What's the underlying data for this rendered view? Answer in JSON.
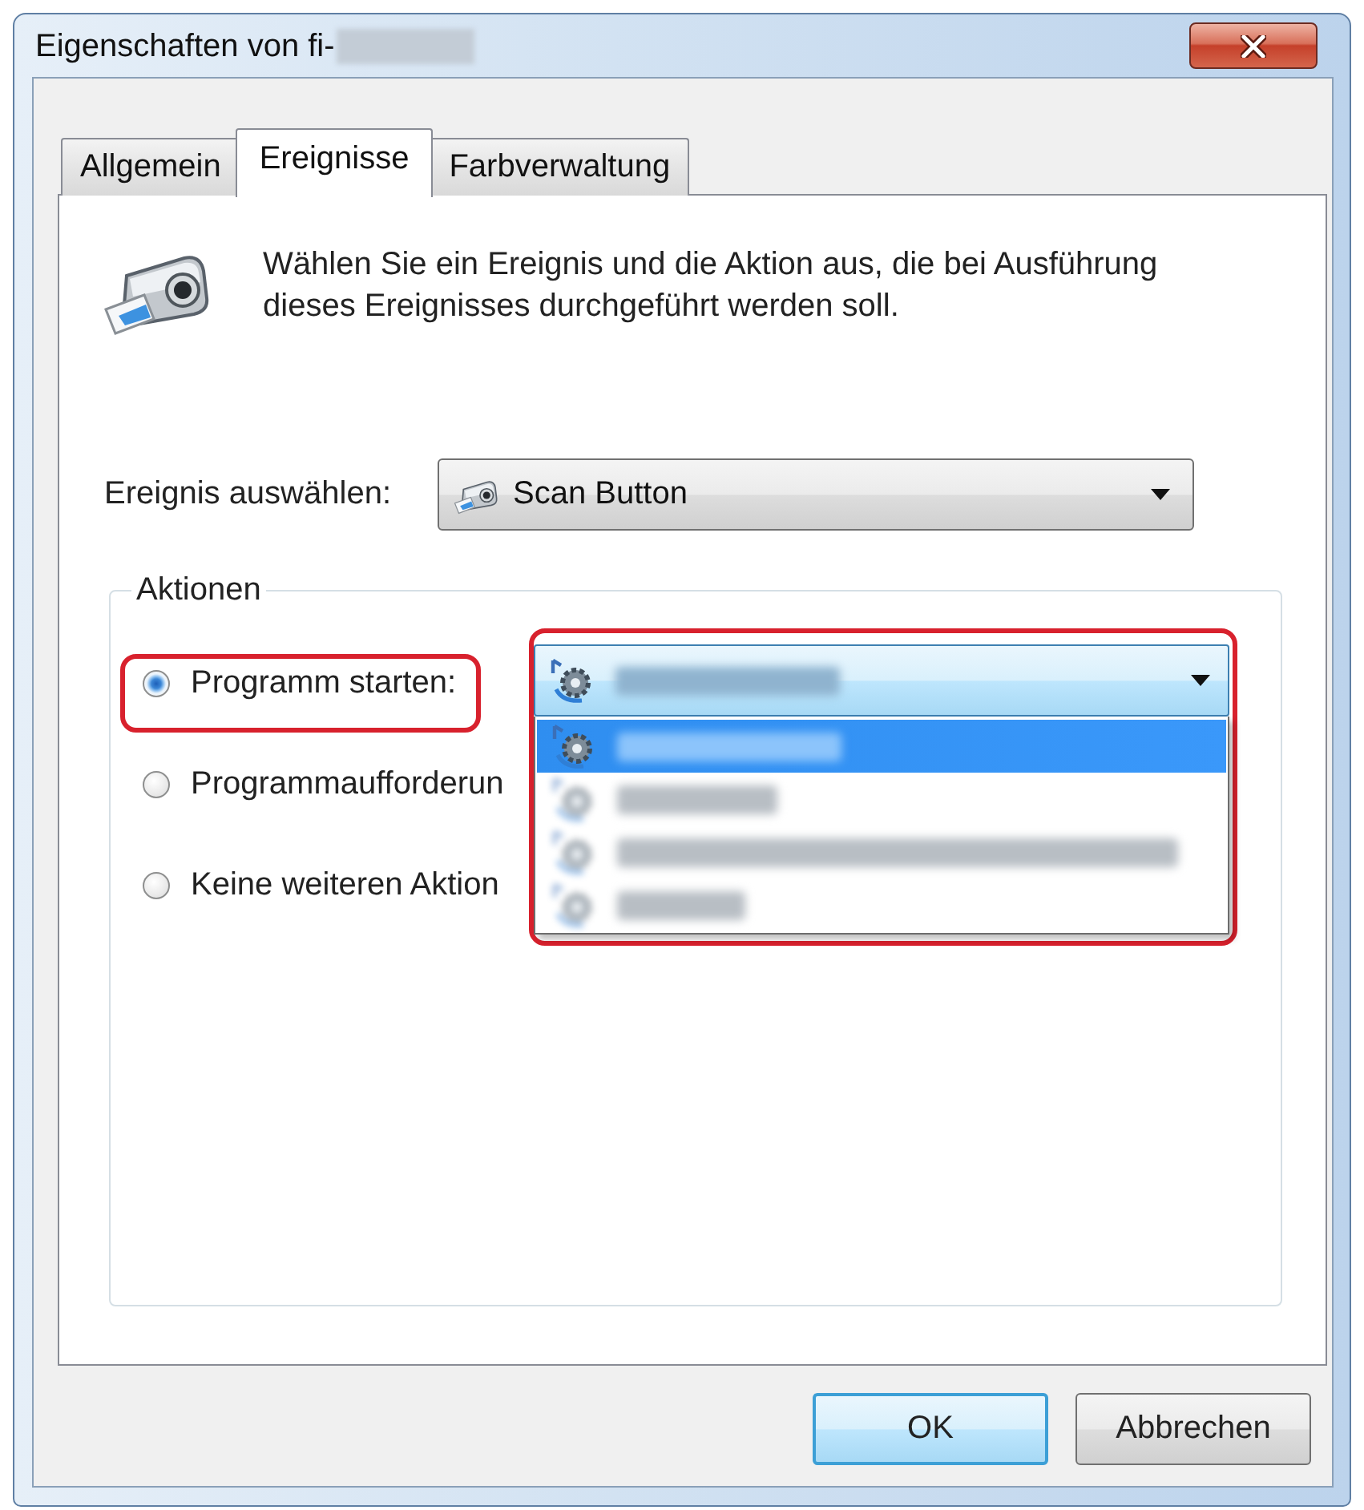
{
  "window": {
    "title": "Eigenschaften von fi-",
    "title_redacted": true
  },
  "tabs": [
    {
      "label": "Allgemein",
      "selected": false
    },
    {
      "label": "Ereignisse",
      "selected": true
    },
    {
      "label": "Farbverwaltung",
      "selected": false
    }
  ],
  "description": "Wählen Sie ein Ereignis und die Aktion aus, die bei Ausführung dieses Ereignisses durchgeführt werden soll.",
  "event_select": {
    "label": "Ereignis auswählen:",
    "value": "Scan Button"
  },
  "actions": {
    "title": "Aktionen",
    "options": [
      {
        "label": "Programm starten:",
        "selected": true,
        "highlighted": true
      },
      {
        "label": "Programmaufforderun",
        "selected": false,
        "highlighted": false
      },
      {
        "label": "Keine weiteren Aktion",
        "selected": false,
        "highlighted": false
      }
    ],
    "program_select": {
      "expanded": true,
      "highlighted": true,
      "value_redacted": true,
      "items": [
        {
          "selected": true
        },
        {
          "selected": false
        },
        {
          "selected": false
        },
        {
          "selected": false
        }
      ]
    }
  },
  "buttons": [
    {
      "label": "OK",
      "default": true
    },
    {
      "label": "Abbrechen",
      "default": false
    }
  ]
}
